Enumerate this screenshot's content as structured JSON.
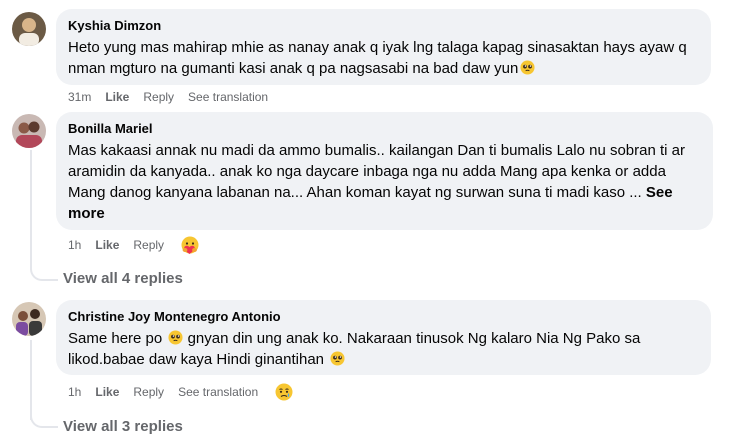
{
  "comments": [
    {
      "author": "Kyshia Dimzon",
      "text": "Heto yung mas mahirap mhie as nanay anak q iyak lng talaga kapag sinasaktan hays ayaw q nman mgturo na gumanti kasi anak q pa nagsasabi na bad daw yun",
      "time": "31m",
      "like": "Like",
      "reply": "Reply",
      "translate": "See translation"
    },
    {
      "author": "Bonilla Mariel",
      "text": "Mas kakaasi annak nu madi da ammo bumalis.. kailangan Dan ti bumalis Lalo nu sobran ti ar aramidin da kanyada.. anak ko nga daycare inbaga nga nu adda Mang apa kenka or adda Mang danog kanyana labanan na... Ahan koman kayat ng surwan suna ti madi kaso ...",
      "see_more": "See more",
      "time": "1h",
      "like": "Like",
      "reply": "Reply",
      "view_replies": "View all 4 replies"
    },
    {
      "author": "Christine Joy Montenegro Antonio",
      "text1": "Same here po",
      "text2": "gnyan din ung anak ko. Nakaraan tinusok Ng kalaro Nia Ng Pako sa likod.babae daw kaya Hindi ginantihan",
      "time": "1h",
      "like": "Like",
      "reply": "Reply",
      "translate": "See translation",
      "view_replies": "View all 3 replies"
    }
  ],
  "colors": {
    "bubble": "#f0f2f5",
    "meta": "#65676b",
    "text": "#050505",
    "thread_line": "#e4e6eb"
  },
  "icons": [
    "pleading-face-emoji",
    "care-reaction-icon",
    "sad-reaction-icon"
  ]
}
